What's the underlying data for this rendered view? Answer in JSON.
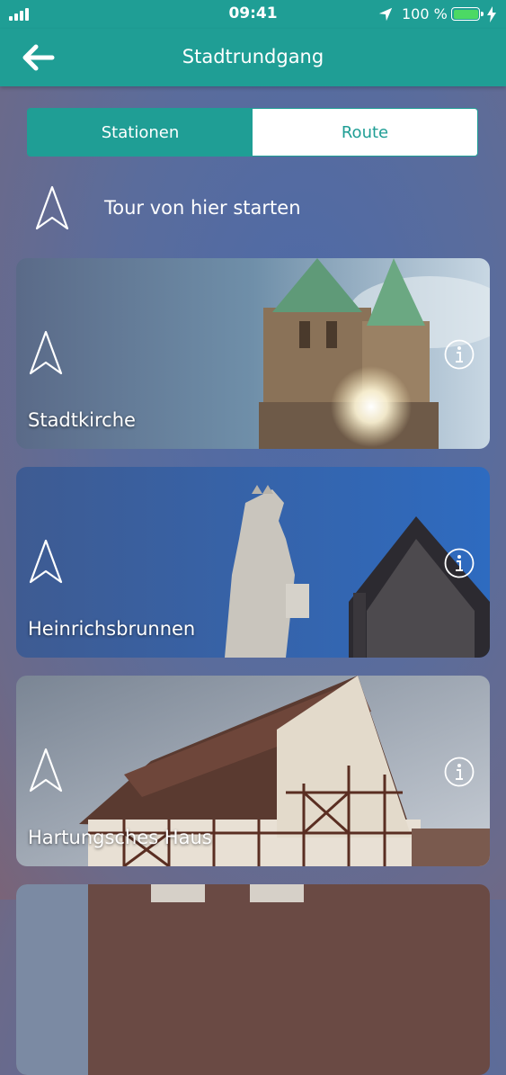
{
  "status_bar": {
    "time": "09:41",
    "battery_percent": "100 %"
  },
  "nav": {
    "title": "Stadtrundgang"
  },
  "tabs": [
    {
      "label": "Stationen",
      "active": true
    },
    {
      "label": "Route",
      "active": false
    }
  ],
  "tour_start": {
    "label": "Tour von hier starten"
  },
  "stations": [
    {
      "name": "Stadtkirche"
    },
    {
      "name": "Heinrichsbrunnen"
    },
    {
      "name": "Hartungsches Haus"
    }
  ],
  "colors": {
    "accent": "#1f9e95",
    "battery": "#4cd964"
  },
  "icons": {
    "back": "arrow-left-icon",
    "navigate": "navigation-arrow-icon",
    "info": "info-icon"
  }
}
